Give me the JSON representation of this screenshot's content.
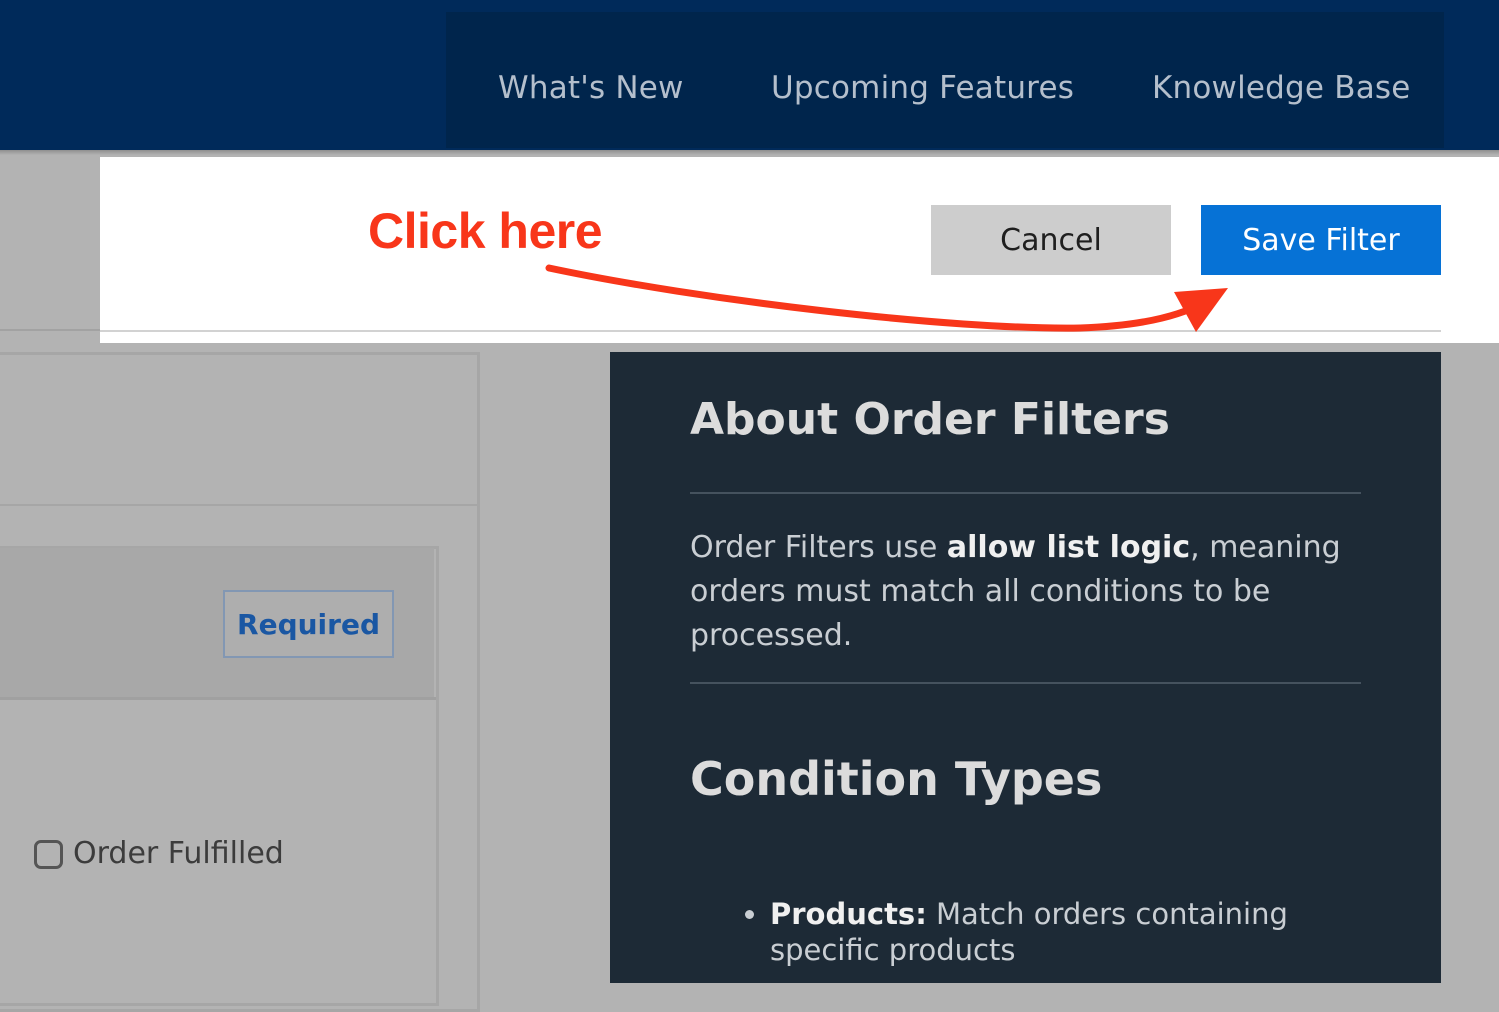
{
  "nav": {
    "items": [
      {
        "label": "What's New"
      },
      {
        "label": "Upcoming Features"
      },
      {
        "label": "Knowledge Base"
      }
    ]
  },
  "toolbar": {
    "cancel_label": "Cancel",
    "save_label": "Save Filter"
  },
  "annotation": {
    "text": "Click here",
    "color": "#f8361a"
  },
  "form": {
    "required_badge": "Required",
    "checkbox_label": "Order Fulfilled",
    "checkbox_checked": false
  },
  "info": {
    "title": "About Order Filters",
    "body_prefix": "Order Filters use ",
    "body_bold": "allow list logic",
    "body_suffix": ", meaning orders must match all conditions to be processed.",
    "subtitle": "Condition Types",
    "list": [
      {
        "term": "Products:",
        "description": " Match orders containing specific products"
      }
    ]
  },
  "colors": {
    "header_bg": "#002a5a",
    "primary_button": "#0672d6",
    "info_panel_bg": "#1d2a36"
  }
}
